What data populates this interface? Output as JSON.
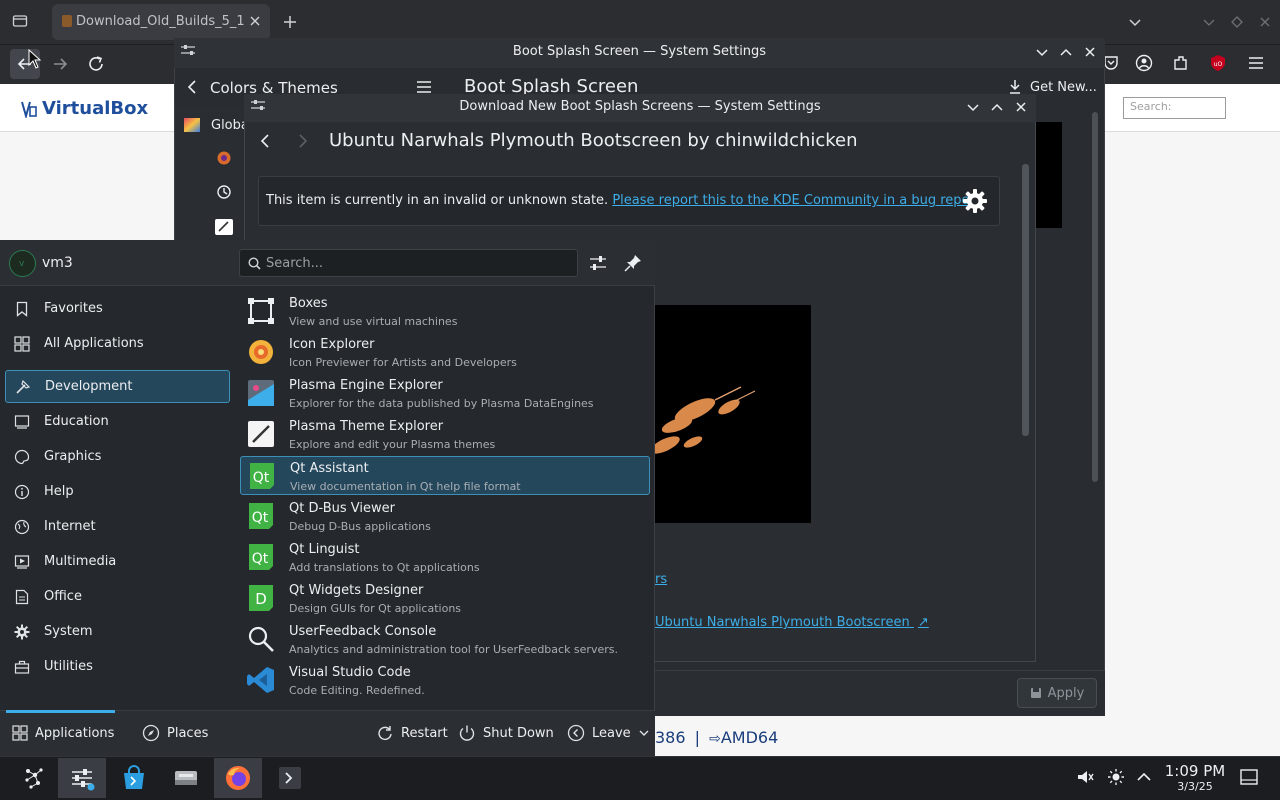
{
  "browser": {
    "tab_title": "Download_Old_Builds_5_1",
    "page": {
      "logo_text": "VirtualBox",
      "search_placeholder": "Search:",
      "arch_fragment": "386",
      "arch_separator": "|",
      "arch_label": "AMD64"
    }
  },
  "settings_window": {
    "title": "Boot Splash Screen — System Settings",
    "breadcrumb": "Colors & Themes",
    "page_title": "Boot Splash Screen",
    "get_new_label": "Get New...",
    "sidebar_items": [
      {
        "label": "Global"
      }
    ],
    "apply_label": "Apply"
  },
  "download_dialog": {
    "title": "Download New Boot Splash Screens — System Settings",
    "heading": "Ubuntu Narwhals Plymouth Bootscreen by chinwildchicken",
    "message_text": "This item is currently in an invalid or unknown state.",
    "message_link": "Please report this to the KDE Community in a bug report",
    "message_period": ".",
    "link_top": "rs",
    "link_bottom": "Ubuntu Narwhals Plymouth Bootscreen"
  },
  "launcher": {
    "username": "vm3",
    "search_placeholder": "Search...",
    "categories": [
      {
        "label": "Favorites",
        "icon": "bookmark-icon"
      },
      {
        "label": "All Applications",
        "icon": "grid-icon"
      },
      {
        "label": "Development",
        "icon": "hammer-icon",
        "active": true
      },
      {
        "label": "Education",
        "icon": "monitor-icon"
      },
      {
        "label": "Graphics",
        "icon": "palette-icon"
      },
      {
        "label": "Help",
        "icon": "info-icon"
      },
      {
        "label": "Internet",
        "icon": "globe-icon"
      },
      {
        "label": "Multimedia",
        "icon": "multimedia-icon"
      },
      {
        "label": "Office",
        "icon": "document-icon"
      },
      {
        "label": "System",
        "icon": "gear-icon"
      },
      {
        "label": "Utilities",
        "icon": "toolbox-icon"
      }
    ],
    "apps": [
      {
        "name": "Boxes",
        "desc": "View and use virtual machines",
        "icon": "boxes-icon"
      },
      {
        "name": "Icon Explorer",
        "desc": "Icon Previewer for Artists and Developers",
        "icon": "icon-explorer-icon"
      },
      {
        "name": "Plasma Engine Explorer",
        "desc": "Explorer for the data published by Plasma DataEngines",
        "icon": "plasma-engine-icon"
      },
      {
        "name": "Plasma Theme Explorer",
        "desc": "Explore and edit your Plasma themes",
        "icon": "plasma-theme-icon"
      },
      {
        "name": "Qt Assistant",
        "desc": "View documentation in Qt help file format",
        "icon": "qt-icon",
        "active": true
      },
      {
        "name": "Qt D-Bus Viewer",
        "desc": "Debug D-Bus applications",
        "icon": "qt-icon"
      },
      {
        "name": "Qt Linguist",
        "desc": "Add translations to Qt applications",
        "icon": "qt-icon"
      },
      {
        "name": "Qt Widgets Designer",
        "desc": "Design GUIs for Qt applications",
        "icon": "qt-designer-icon"
      },
      {
        "name": "UserFeedback Console",
        "desc": "Analytics and administration tool for UserFeedback servers.",
        "icon": "magnifier-icon"
      },
      {
        "name": "Visual Studio Code",
        "desc": "Code Editing. Redefined.",
        "icon": "vscode-icon"
      }
    ],
    "footer": {
      "applications_label": "Applications",
      "places_label": "Places",
      "restart_label": "Restart",
      "shutdown_label": "Shut Down",
      "leave_label": "Leave"
    }
  },
  "taskbar": {
    "time": "1:09 PM",
    "date": "3/3/25"
  },
  "colors": {
    "accent": "#3daee9",
    "selection": "#24475c",
    "panel": "#25282c"
  }
}
